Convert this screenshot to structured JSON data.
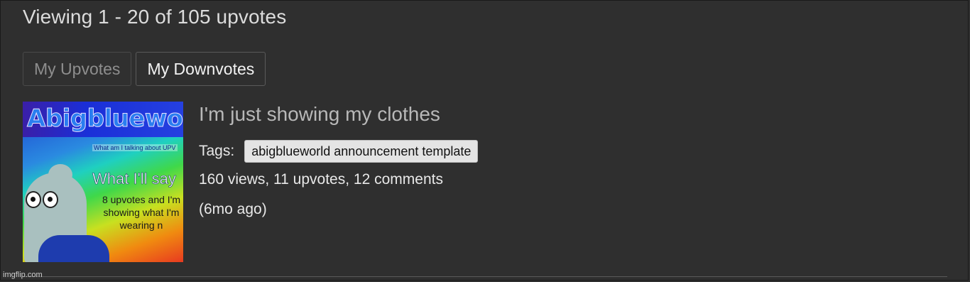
{
  "header": {
    "viewing_text": "Viewing 1 - 20 of 105 upvotes"
  },
  "tabs": [
    {
      "label": "My Upvotes",
      "active": false
    },
    {
      "label": "My Downvotes",
      "active": true
    }
  ],
  "item": {
    "thumbnail": {
      "title": "Abigblueworld",
      "small_text": "What am I talking about UPV",
      "say_text": "What I'll say",
      "sub_text": "8 upvotes and I'm showing what I'm wearing n"
    },
    "title": "I'm just showing my clothes",
    "tags_label": "Tags:",
    "tags": [
      "abigblueworld announcement template"
    ],
    "stats": "160 views, 11 upvotes, 12 comments",
    "time_ago": "(6mo ago)"
  },
  "watermark": "imgflip.com",
  "colors": {
    "background": "#2f2f2f",
    "text": "#e8e8e8",
    "tag_bg": "#e4e4e4"
  }
}
